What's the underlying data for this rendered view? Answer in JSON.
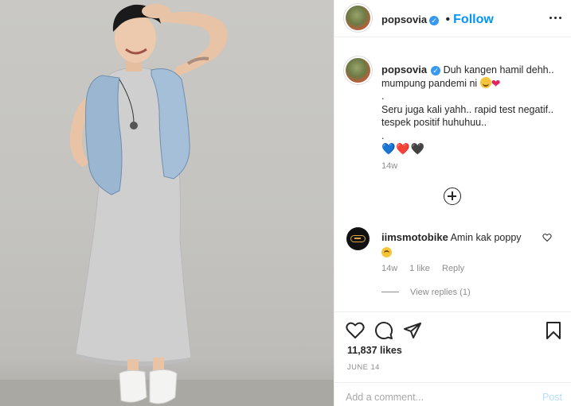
{
  "post": {
    "author": "popsovia",
    "follow_label": "Follow",
    "separator": "•"
  },
  "caption": {
    "username": "popsovia",
    "line1": "Duh kangen hamil dehh.. mumpung pandemi ni",
    "dot1": ".",
    "line2": "Seru juga kali yahh.. rapid test negatif.. tespek positif huhuhuu..",
    "dot2": ".",
    "hearts": "💙❤️🖤",
    "timestamp": "14w"
  },
  "comment": {
    "username": "iimsmotobike",
    "text": "Amin kak poppy",
    "timestamp": "14w",
    "likes": "1 like",
    "reply_label": "Reply",
    "view_replies": "View replies (1)"
  },
  "stats": {
    "likes": "11,837 likes",
    "date": "JUNE 14"
  },
  "composer": {
    "placeholder": "Add a comment...",
    "post_label": "Post"
  },
  "icons": {
    "like": "heart-outline-icon",
    "comment": "comment-bubble-icon",
    "share": "paper-plane-icon",
    "save": "bookmark-icon",
    "more": "more-horizontal-icon",
    "load_more": "plus-circle-icon"
  },
  "colors": {
    "accent": "#0095f6",
    "verified": "#3897f0",
    "muted": "#8e8e8e",
    "text": "#262626",
    "post_disabled": "#b2dffc"
  }
}
